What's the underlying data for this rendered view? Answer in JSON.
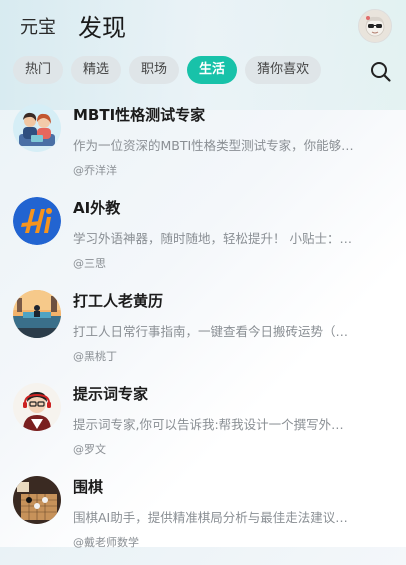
{
  "header": {
    "brand": "元宝",
    "title": "发现"
  },
  "tabs": [
    {
      "label": "热门",
      "active": false
    },
    {
      "label": "精选",
      "active": false
    },
    {
      "label": "职场",
      "active": false
    },
    {
      "label": "生活",
      "active": true
    },
    {
      "label": "猜你喜欢",
      "active": false
    }
  ],
  "icons": {
    "search": "search-icon",
    "user": "user-avatar"
  },
  "colors": {
    "accent": "#18c2a9"
  },
  "agents": [
    {
      "title": "MBTI性格测试专家",
      "desc": "作为一位资深的MBTI性格类型测试专家，你能够…",
      "author": "@乔洋洋",
      "icon": "mbti-couple-avatar"
    },
    {
      "title": "AI外教",
      "desc": "学习外语神器，随时随地，轻松提升！ 小贴士：…",
      "author": "@三思",
      "icon": "ai-tutor-logo"
    },
    {
      "title": "打工人老黄历",
      "desc": "打工人日常行事指南，一键查看今日搬砖运势（…",
      "author": "@黑桃丁",
      "icon": "worker-almanac-avatar"
    },
    {
      "title": "提示词专家",
      "desc": "提示词专家,你可以告诉我:帮我设计一个撰写外…",
      "author": "@罗文",
      "icon": "prompt-expert-avatar"
    },
    {
      "title": "围棋",
      "desc": "围棋AI助手，提供精准棋局分析与最佳走法建议…",
      "author": "@戴老师数学",
      "icon": "go-board-avatar"
    }
  ]
}
